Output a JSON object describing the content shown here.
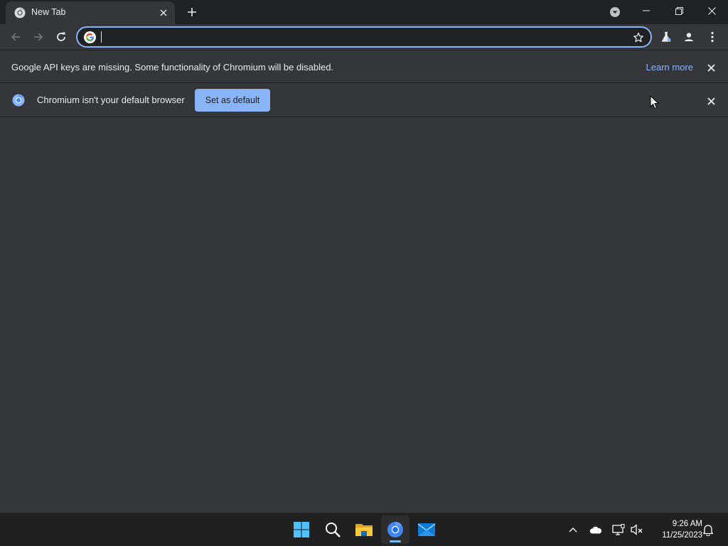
{
  "browser": {
    "tab": {
      "title": "New Tab",
      "favicon": "chromium-icon"
    },
    "window_controls": [
      "minimize-icon",
      "restore-icon",
      "close-icon"
    ],
    "omnibox": {
      "value": "",
      "placeholder": ""
    },
    "toolbar_icons": [
      "back-arrow-icon",
      "forward-arrow-icon",
      "reload-icon",
      "bookmark-star-icon",
      "labs-flask-icon",
      "profile-icon",
      "menu-dots-icon"
    ]
  },
  "infobars": {
    "api_keys": {
      "message": "Google API keys are missing. Some functionality of Chromium will be disabled.",
      "link": "Learn more"
    },
    "default_browser": {
      "message": "Chromium isn't your default browser",
      "button": "Set as default"
    }
  },
  "taskbar": {
    "apps": [
      "windows-start-icon",
      "search-icon",
      "file-explorer-icon",
      "chromium-icon",
      "mail-icon"
    ],
    "active_app": "chromium-icon",
    "tray_icons": [
      "chevron-up-icon",
      "onedrive-cloud-icon",
      "network-icon",
      "volume-muted-icon",
      "notification-bell-icon"
    ],
    "clock": {
      "time": "9:26 AM",
      "date": "11/25/2023"
    }
  },
  "colors": {
    "tabstrip": "#202124",
    "toolbar": "#35363a",
    "accent": "#8ab4f8",
    "taskbar": "#202020",
    "text": "#e8eaed"
  }
}
